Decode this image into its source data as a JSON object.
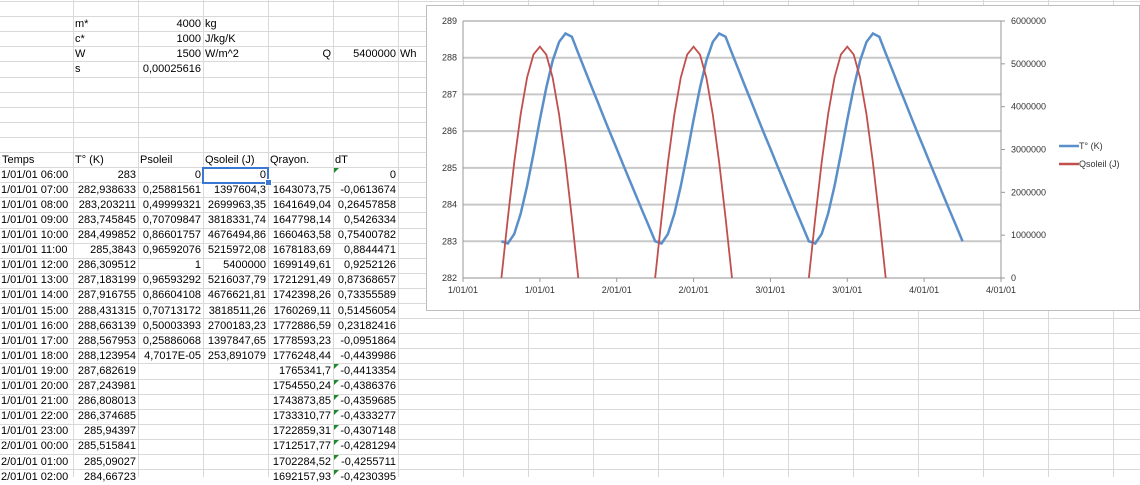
{
  "params": [
    {
      "label": "m*",
      "value": "4000",
      "unit": "kg"
    },
    {
      "label": "c*",
      "value": "1000",
      "unit": "J/kg/K"
    },
    {
      "label": "W",
      "value": "1500",
      "unit": "W/m^2"
    },
    {
      "label": "s",
      "value": "0,00025616",
      "unit": ""
    }
  ],
  "q_param": {
    "label": "Q",
    "value": "5400000",
    "unit": "Wh"
  },
  "table": {
    "headers": [
      "Temps",
      "T° (K)",
      "Psoleil",
      "Qsoleil (J)",
      "Qrayon.",
      "dT"
    ],
    "rows": [
      [
        "1/01/01 06:00",
        "283",
        "0",
        "0",
        "",
        "0"
      ],
      [
        "1/01/01 07:00",
        "282,938633",
        "0,25881561",
        "1397604,3",
        "1643073,75",
        "-0,0613674"
      ],
      [
        "1/01/01 08:00",
        "283,203211",
        "0,49999321",
        "2699963,35",
        "1641649,04",
        "0,26457858"
      ],
      [
        "1/01/01 09:00",
        "283,745845",
        "0,70709847",
        "3818331,74",
        "1647798,14",
        "0,5426334"
      ],
      [
        "1/01/01 10:00",
        "284,499852",
        "0,86601757",
        "4676494,86",
        "1660463,58",
        "0,75400782"
      ],
      [
        "1/01/01 11:00",
        "285,3843",
        "0,96592076",
        "5215972,08",
        "1678183,69",
        "0,8844471"
      ],
      [
        "1/01/01 12:00",
        "286,309512",
        "1",
        "5400000",
        "1699149,61",
        "0,9252126"
      ],
      [
        "1/01/01 13:00",
        "287,183199",
        "0,96593292",
        "5216037,79",
        "1721291,49",
        "0,87368657"
      ],
      [
        "1/01/01 14:00",
        "287,916755",
        "0,86604108",
        "4676621,81",
        "1742398,26",
        "0,73355589"
      ],
      [
        "1/01/01 15:00",
        "288,431315",
        "0,70713172",
        "3818511,26",
        "1760269,11",
        "0,51456054"
      ],
      [
        "1/01/01 16:00",
        "288,663139",
        "0,50003393",
        "2700183,23",
        "1772886,59",
        "0,23182416"
      ],
      [
        "1/01/01 17:00",
        "288,567953",
        "0,25886068",
        "1397847,65",
        "1778593,23",
        "-0,0951864"
      ],
      [
        "1/01/01 18:00",
        "288,123954",
        "4,7017E-05",
        "253,891079",
        "1776248,44",
        "-0,4439986"
      ],
      [
        "1/01/01 19:00",
        "287,682619",
        "",
        "",
        "1765341,7",
        "-0,4413354"
      ],
      [
        "1/01/01 20:00",
        "287,243981",
        "",
        "",
        "1754550,24",
        "-0,4386376"
      ],
      [
        "1/01/01 21:00",
        "286,808013",
        "",
        "",
        "1743873,85",
        "-0,4359685"
      ],
      [
        "1/01/01 22:00",
        "286,374685",
        "",
        "",
        "1733310,77",
        "-0,4333277"
      ],
      [
        "1/01/01 23:00",
        "285,94397",
        "",
        "",
        "1722859,31",
        "-0,4307148"
      ],
      [
        "2/01/01 00:00",
        "285,515841",
        "",
        "",
        "1712517,77",
        "-0,4281294"
      ],
      [
        "2/01/01 01:00",
        "285,09027",
        "",
        "",
        "1702284,52",
        "-0,4255711"
      ],
      [
        "2/01/01 02:00",
        "284,66723",
        "",
        "",
        "1692157,93",
        "-0,4230395"
      ]
    ]
  },
  "chart_data": {
    "type": "line",
    "x_start": "1/01/01 06:00",
    "x_step_hours": 1,
    "x_tick_labels": [
      "1/01/01",
      "1/01/01",
      "2/01/01",
      "2/01/01",
      "3/01/01",
      "3/01/01",
      "4/01/01",
      "4/01/01"
    ],
    "y_left": {
      "range": [
        282,
        289
      ],
      "ticks": [
        "282",
        "283",
        "284",
        "285",
        "286",
        "287",
        "288",
        "289"
      ]
    },
    "y_right": {
      "range": [
        0,
        6000000
      ],
      "ticks": [
        "0",
        "1000000",
        "2000000",
        "3000000",
        "4000000",
        "5000000",
        "6000000"
      ]
    },
    "grid": true,
    "legend_position": "right",
    "series": [
      {
        "name": "T° (K)",
        "axis": "left",
        "color": "#5b8fc9",
        "values": [
          283,
          282.94,
          283.2,
          283.75,
          284.5,
          285.38,
          286.31,
          287.18,
          287.92,
          288.43,
          288.66,
          288.57,
          288.12,
          287.68,
          287.24,
          286.81,
          286.37,
          285.94,
          285.52,
          285.09,
          284.67,
          284.25,
          283.83,
          283.42,
          283,
          282.94,
          283.2,
          283.75,
          284.5,
          285.38,
          286.31,
          287.18,
          287.92,
          288.43,
          288.66,
          288.57,
          288.12,
          287.68,
          287.24,
          286.81,
          286.37,
          285.94,
          285.52,
          285.09,
          284.67,
          284.25,
          283.83,
          283.42,
          283,
          282.94,
          283.2,
          283.75,
          284.5,
          285.38,
          286.31,
          287.18,
          287.92,
          288.43,
          288.66,
          288.57,
          288.12,
          287.68,
          287.24,
          286.81,
          286.37,
          285.94,
          285.52,
          285.09,
          284.67,
          284.25,
          283.83,
          283.42,
          283
        ]
      },
      {
        "name": "Qsoleil (J)",
        "axis": "right",
        "color": "#c0504d",
        "values": [
          0,
          1397604,
          2699963,
          3818332,
          4676495,
          5215972,
          5400000,
          5216038,
          4676622,
          3818511,
          2700183,
          1397848,
          254,
          null,
          null,
          null,
          null,
          null,
          null,
          null,
          null,
          null,
          null,
          null,
          0,
          1397604,
          2699963,
          3818332,
          4676495,
          5215972,
          5400000,
          5216038,
          4676622,
          3818511,
          2700183,
          1397848,
          254,
          null,
          null,
          null,
          null,
          null,
          null,
          null,
          null,
          null,
          null,
          null,
          0,
          1397604,
          2699963,
          3818332,
          4676495,
          5215972,
          5400000,
          5216038,
          4676622,
          3818511,
          2700183,
          1397848,
          254,
          null,
          null,
          null,
          null,
          null,
          null,
          null,
          null,
          null,
          null,
          null,
          null
        ]
      }
    ]
  }
}
